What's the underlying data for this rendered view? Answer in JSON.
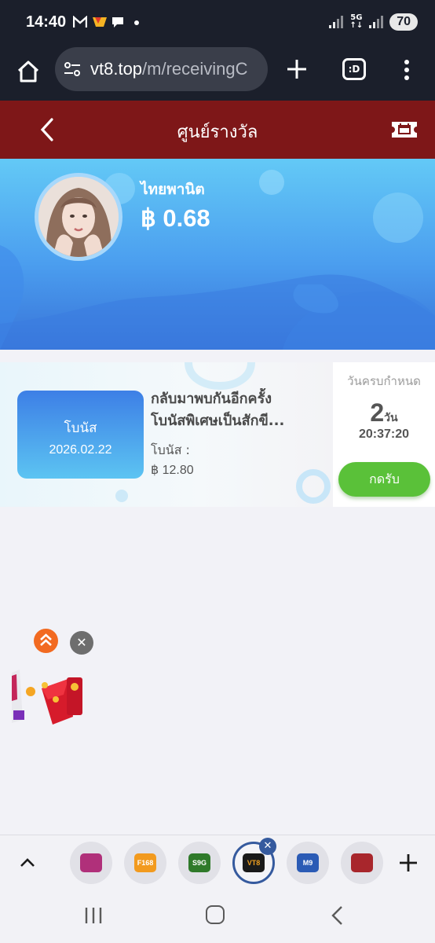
{
  "status_bar": {
    "time": "14:40",
    "notifications": [
      "mail-icon",
      "shop-icon",
      "chat-icon",
      "dot-icon"
    ],
    "network": "5G",
    "battery": "70"
  },
  "browser": {
    "url_host": "vt8.top",
    "url_path": "/m/receivingC",
    "tabs_label": ":D"
  },
  "header": {
    "title": "ศูนย์รางวัล"
  },
  "profile": {
    "username": "ไทยพานิต",
    "balance": "฿ 0.68"
  },
  "reward": {
    "badge_label": "โบนัส",
    "badge_date": "2026.02.22",
    "title_line1": "กลับมาพบกันอีกครั้ง",
    "title_line2": "โบนัสพิเศษเป็นสักขี...",
    "bonus_label": "โบนัส :",
    "bonus_amount": "฿ 12.80",
    "due_label": "วันครบกำหนด",
    "days_value": "2",
    "days_unit": "วัน",
    "countdown": "20:37:20",
    "claim_label": "กดรับ"
  },
  "promo": {
    "close_symbol": "✕"
  },
  "tab_strip": {
    "tabs": [
      {
        "label": "",
        "color": "#b0307a"
      },
      {
        "label": "F168",
        "color": "#f29a1e"
      },
      {
        "label": "S9G",
        "color": "#2f7a2a"
      },
      {
        "label": "VT8",
        "color": "#1a1a1a"
      },
      {
        "label": "M9",
        "color": "#2b5bb5"
      },
      {
        "label": "",
        "color": "#a8262c"
      }
    ],
    "close_symbol": "✕"
  },
  "colors": {
    "header_bg": "#7e1718",
    "claim_green": "#5ac139",
    "hero_blue": "#4b9eef"
  }
}
